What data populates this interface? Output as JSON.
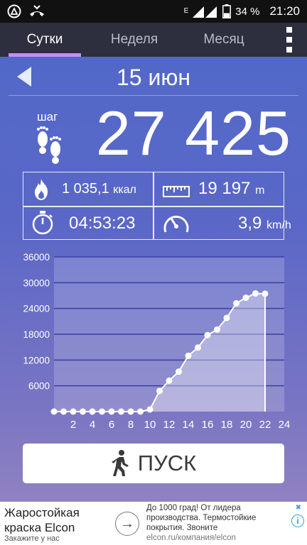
{
  "status_bar": {
    "battery": "34 %",
    "time": "21:20",
    "network": "E",
    "icons": [
      "notification-icon",
      "missed-call-icon",
      "signal-icon",
      "battery-icon"
    ]
  },
  "tabs": [
    {
      "label": "Сутки",
      "active": true
    },
    {
      "label": "Неделя",
      "active": false
    },
    {
      "label": "Месяц",
      "active": false
    }
  ],
  "date": "15 июн",
  "steps": {
    "label": "шаг",
    "value": "27 425"
  },
  "stats": {
    "calories": {
      "value": "1 035,1",
      "unit": "ккал"
    },
    "distance": {
      "value": "19 197",
      "unit": "m"
    },
    "duration": {
      "value": "04:53:23"
    },
    "speed": {
      "value": "3,9",
      "unit": "km/h"
    }
  },
  "chart_data": {
    "type": "area",
    "x": [
      0,
      1,
      2,
      3,
      4,
      5,
      6,
      7,
      8,
      9,
      10,
      11,
      12,
      13,
      14,
      15,
      16,
      17,
      18,
      19,
      20,
      21,
      22
    ],
    "values": [
      0,
      0,
      0,
      0,
      0,
      0,
      0,
      0,
      0,
      0,
      500,
      4800,
      7200,
      9300,
      13000,
      14900,
      17800,
      19100,
      21800,
      25200,
      26500,
      27500,
      27425
    ],
    "xticks": [
      "2",
      "4",
      "6",
      "8",
      "10",
      "12",
      "14",
      "16",
      "18",
      "20",
      "22",
      "24"
    ],
    "yticks": [
      "6000",
      "12000",
      "18000",
      "24000",
      "30000",
      "36000"
    ],
    "xlim": [
      0,
      24
    ],
    "ylim": [
      0,
      36000
    ],
    "grid": true
  },
  "start_button": {
    "label": "ПУСК"
  },
  "ad": {
    "title": "Жаростойкая краска Elcon",
    "subtitle": "Закажите у нас",
    "text": "До 1000 град! От лидера производства. Термостойкие покрытия. Звоните",
    "url": "elcon.ru/компания/elcon"
  },
  "colors": {
    "accent": "#c58ef5",
    "tabbar": "#2d2f3e",
    "background": "#5a67c7"
  }
}
